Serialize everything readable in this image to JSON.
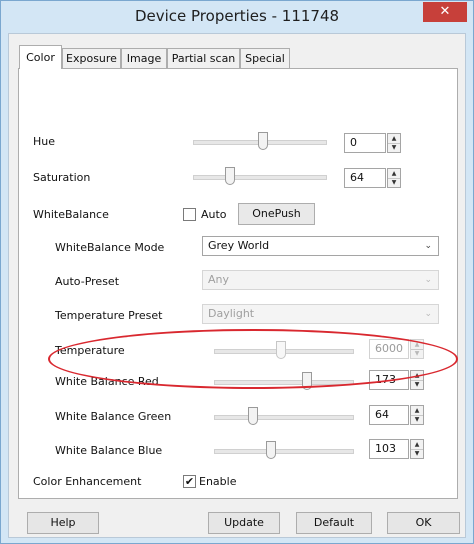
{
  "window": {
    "title": "Device Properties - 111748",
    "close_glyph": "✕"
  },
  "tabs": [
    {
      "label": "Color",
      "active": true
    },
    {
      "label": "Exposure",
      "active": false
    },
    {
      "label": "Image",
      "active": false
    },
    {
      "label": "Partial scan",
      "active": false
    },
    {
      "label": "Special",
      "active": false
    }
  ],
  "color_tab": {
    "hue": {
      "label": "Hue",
      "value": "0"
    },
    "saturation": {
      "label": "Saturation",
      "value": "64"
    },
    "white_balance": {
      "label": "WhiteBalance",
      "auto_label": "Auto",
      "auto_checked": false,
      "onepush_label": "OnePush",
      "mode": {
        "label": "WhiteBalance Mode",
        "value": "Grey World"
      },
      "auto_preset": {
        "label": "Auto-Preset",
        "value": "Any"
      },
      "temperature_preset": {
        "label": "Temperature Preset",
        "value": "Daylight"
      },
      "temperature": {
        "label": "Temperature",
        "value": "6000"
      },
      "red": {
        "label": "White Balance Red",
        "value": "173"
      },
      "green": {
        "label": "White Balance Green",
        "value": "64"
      },
      "blue": {
        "label": "White Balance Blue",
        "value": "103"
      }
    },
    "color_enhancement": {
      "label": "Color Enhancement",
      "enable_label": "Enable",
      "enabled": true,
      "check_glyph": "✔"
    }
  },
  "footer": {
    "help": "Help",
    "update": "Update",
    "default": "Default",
    "ok": "OK"
  },
  "icons": {
    "spin_up": "▲",
    "spin_down": "▼",
    "combo_arrow": "⌄"
  },
  "colors": {
    "titlebar": "#d3e6f5",
    "close_button": "#c7403a",
    "annotation": "#d9282f"
  }
}
